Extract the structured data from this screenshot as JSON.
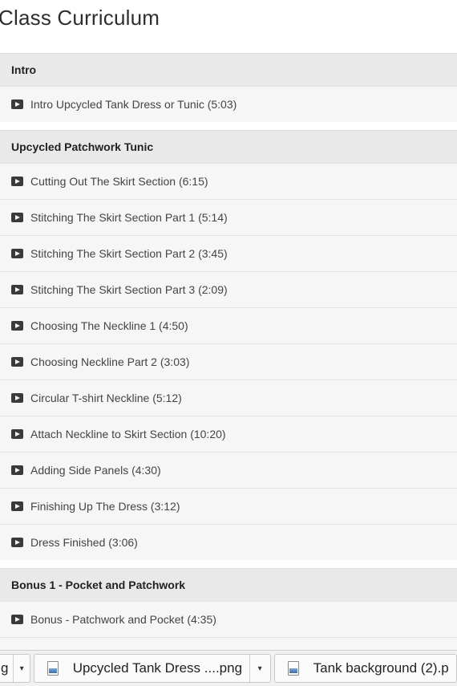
{
  "page": {
    "title": "Class Curriculum"
  },
  "sections": [
    {
      "title": "Intro",
      "lectures": [
        "Intro Upcycled Tank Dress or Tunic (5:03)"
      ]
    },
    {
      "title": "Upcycled Patchwork Tunic",
      "lectures": [
        "Cutting Out The Skirt Section (6:15)",
        "Stitching The Skirt Section Part 1 (5:14)",
        "Stitching The Skirt Section Part 2 (3:45)",
        "Stitching The Skirt Section Part 3 (2:09)",
        "Choosing The Neckline 1 (4:50)",
        "Choosing Neckline Part 2 (3:03)",
        "Circular T-shirt Neckline (5:12)",
        "Attach Neckline to Skirt Section (10:20)",
        "Adding Side Panels (4:30)",
        "Finishing Up The Dress (3:12)",
        "Dress Finished (3:06)"
      ]
    },
    {
      "title": "Bonus 1 - Pocket and Patchwork",
      "lectures": [
        "Bonus - Patchwork and Pocket (4:35)"
      ]
    }
  ],
  "download_bar": {
    "items": [
      {
        "name": "g"
      },
      {
        "name": "Upcycled Tank Dress ....png"
      },
      {
        "name": "Tank background (2).p"
      }
    ],
    "icons": [
      "chevron-down-icon",
      "image-file-icon"
    ]
  }
}
